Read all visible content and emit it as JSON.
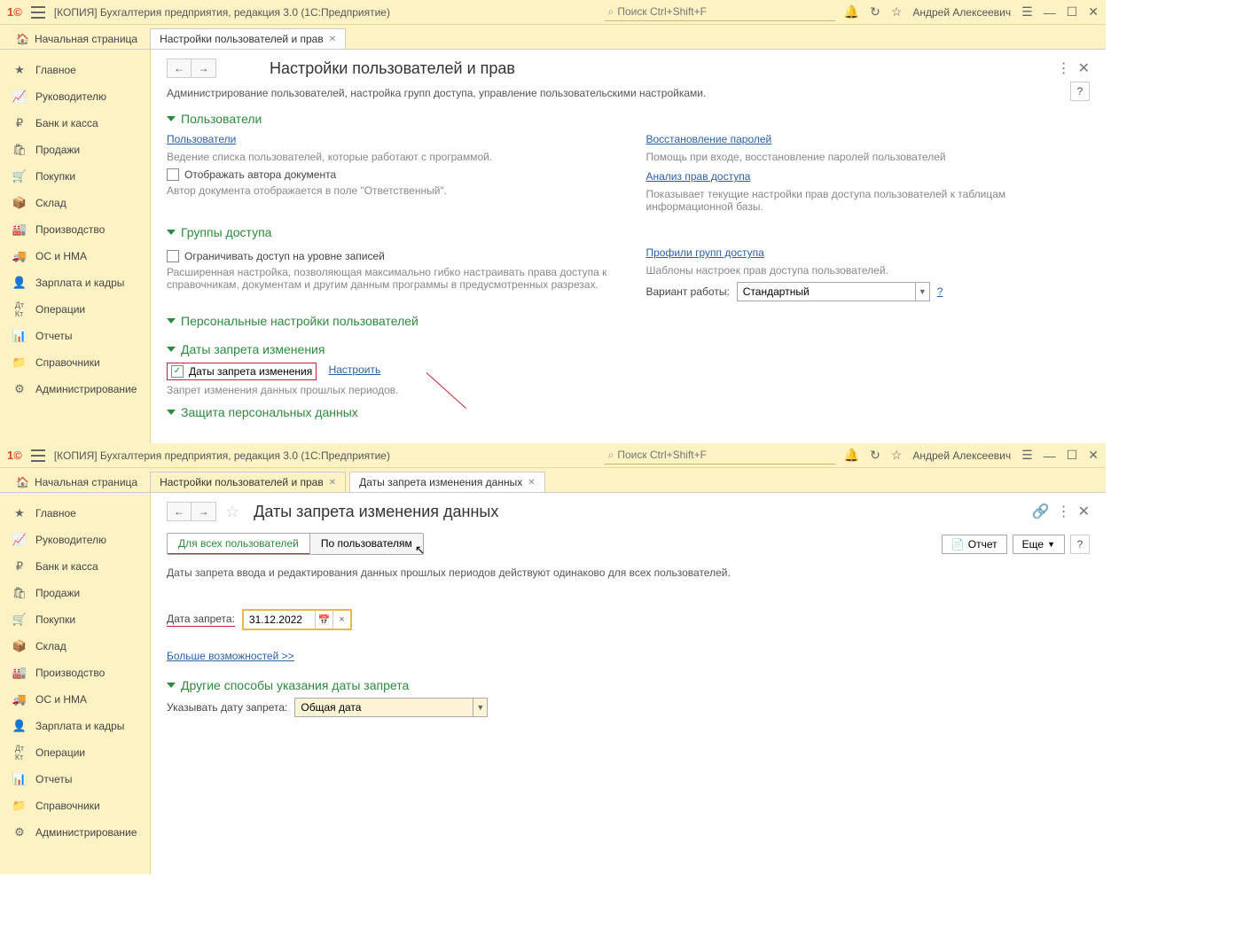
{
  "app": {
    "title": "[КОПИЯ] Бухгалтерия предприятия, редакция 3.0  (1С:Предприятие)",
    "search_placeholder": "Поиск Ctrl+Shift+F",
    "user": "Андрей Алексеевич"
  },
  "tabs_top": {
    "home": "Начальная страница",
    "t1": "Настройки пользователей и прав"
  },
  "tabs_bottom": {
    "home": "Начальная страница",
    "t1": "Настройки пользователей и прав",
    "t2": "Даты запрета изменения данных"
  },
  "nav": [
    "Главное",
    "Руководителю",
    "Банк и касса",
    "Продажи",
    "Покупки",
    "Склад",
    "Производство",
    "ОС и НМА",
    "Зарплата и кадры",
    "Операции",
    "Отчеты",
    "Справочники",
    "Администрирование"
  ],
  "page1": {
    "title": "Настройки пользователей и прав",
    "desc": "Администрирование пользователей, настройка групп доступа, управление пользовательскими настройками.",
    "s_users": "Пользователи",
    "link_users": "Пользователи",
    "hint_users": "Ведение списка пользователей, которые работают с программой.",
    "chk_author": "Отображать автора документа",
    "hint_author": "Автор документа отображается в поле \"Ответственный\".",
    "link_restore": "Восстановление паролей",
    "hint_restore": "Помощь при входе, восстановление паролей пользователей",
    "link_rights": "Анализ прав доступа",
    "hint_rights": "Показывает текущие настройки прав доступа пользователей к таблицам информационной базы.",
    "s_groups": "Группы доступа",
    "chk_restrict": "Ограничивать доступ на уровне записей",
    "hint_restrict": "Расширенная настройка, позволяющая максимально гибко настраивать права доступа к справочникам, документам и другим данным программы в предусмотренных разрезах.",
    "link_profiles": "Профили групп доступа",
    "hint_profiles": "Шаблоны настроек прав доступа пользователей.",
    "lbl_variant": "Вариант работы:",
    "val_variant": "Стандартный",
    "s_personal": "Персональные настройки пользователей",
    "s_dates": "Даты запрета изменения",
    "chk_dates": "Даты запрета изменения",
    "link_configure": "Настроить",
    "hint_dates": "Запрет изменения данных прошлых периодов.",
    "s_protect": "Защита персональных данных"
  },
  "page2": {
    "title": "Даты запрета изменения данных",
    "seg1": "Для всех пользователей",
    "seg2": "По пользователям",
    "btn_report": "Отчет",
    "btn_more": "Еще",
    "desc": "Даты запрета ввода и редактирования данных прошлых периодов действуют одинаково для всех пользователей.",
    "lbl_date": "Дата запрета:",
    "val_date": "31.12.2022",
    "link_more": "Больше возможностей >>",
    "s_other": "Другие способы указания даты запрета",
    "lbl_mode": "Указывать дату запрета:",
    "val_mode": "Общая дата"
  }
}
